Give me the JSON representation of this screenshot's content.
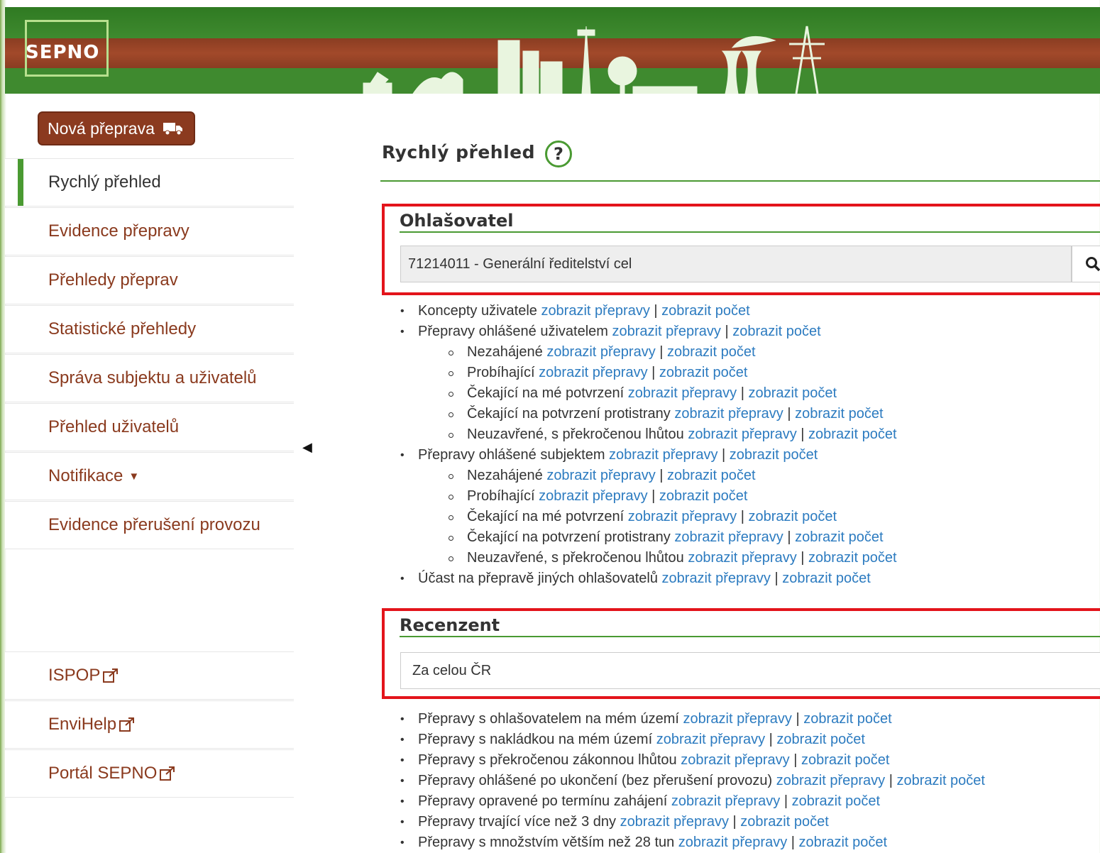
{
  "header": {
    "logo_text": "SEPNO"
  },
  "sidebar": {
    "new_button": {
      "label": "Nová přeprava",
      "icon": "truck-icon"
    },
    "items": [
      {
        "label": "Rychlý přehled",
        "active": true
      },
      {
        "label": "Evidence přepravy"
      },
      {
        "label": "Přehledy přeprav"
      },
      {
        "label": "Statistické přehledy"
      },
      {
        "label": "Správa subjektu a uživatelů"
      },
      {
        "label": "Přehled uživatelů"
      },
      {
        "label": "Notifikace"
      },
      {
        "label": "Evidence přerušení provozu"
      }
    ],
    "external_links": [
      {
        "label": "ISPOP"
      },
      {
        "label": "EnviHelp"
      },
      {
        "label": "Portál SEPNO"
      }
    ]
  },
  "main": {
    "title": "Rychlý přehled",
    "help_symbol": "?",
    "ohlasovatel": {
      "label": "Ohlašovatel",
      "value": "71214011 - Generální ředitelství cel"
    },
    "recenzent": {
      "label": "Recenzent",
      "value": "Za celou ČR"
    },
    "link_show": "zobrazit přepravy",
    "link_count": "zobrazit počet",
    "separator": "|",
    "ohlasovatel_items": [
      {
        "text": "Koncepty uživatele",
        "level": 1
      },
      {
        "text": "Přepravy ohlášené uživatelem",
        "level": 1
      },
      {
        "text": "Nezahájené",
        "level": 2
      },
      {
        "text": "Probíhající",
        "level": 2
      },
      {
        "text": "Čekající na mé potvrzení",
        "level": 2
      },
      {
        "text": "Čekající na potvrzení protistrany",
        "level": 2
      },
      {
        "text": "Neuzavřené, s překročenou lhůtou",
        "level": 2
      },
      {
        "text": "Přepravy ohlášené subjektem",
        "level": 1
      },
      {
        "text": "Nezahájené",
        "level": 2
      },
      {
        "text": "Probíhající",
        "level": 2
      },
      {
        "text": "Čekající na mé potvrzení",
        "level": 2
      },
      {
        "text": "Čekající na potvrzení protistrany",
        "level": 2
      },
      {
        "text": "Neuzavřené, s překročenou lhůtou",
        "level": 2
      },
      {
        "text": "Účast na přepravě jiných ohlašovatelů",
        "level": 1
      }
    ],
    "recenzent_items": [
      {
        "text": "Přepravy s ohlašovatelem na mém území",
        "level": 1
      },
      {
        "text": "Přepravy s nakládkou na mém území",
        "level": 1
      },
      {
        "text": "Přepravy s překročenou zákonnou lhůtou",
        "level": 1
      },
      {
        "text": "Přepravy ohlášené po ukončení (bez přerušení provozu)",
        "level": 1
      },
      {
        "text": "Přepravy opravené po termínu zahájení",
        "level": 1
      },
      {
        "text": "Přepravy trvající více než 3 dny",
        "level": 1
      },
      {
        "text": "Přepravy s množstvím větším než 28 tun",
        "level": 1
      }
    ]
  },
  "colors": {
    "brand_green": "#4a9a32",
    "brand_brown": "#8b3a1f",
    "link_blue": "#2c7bc0",
    "highlight_red": "#e3141b"
  }
}
